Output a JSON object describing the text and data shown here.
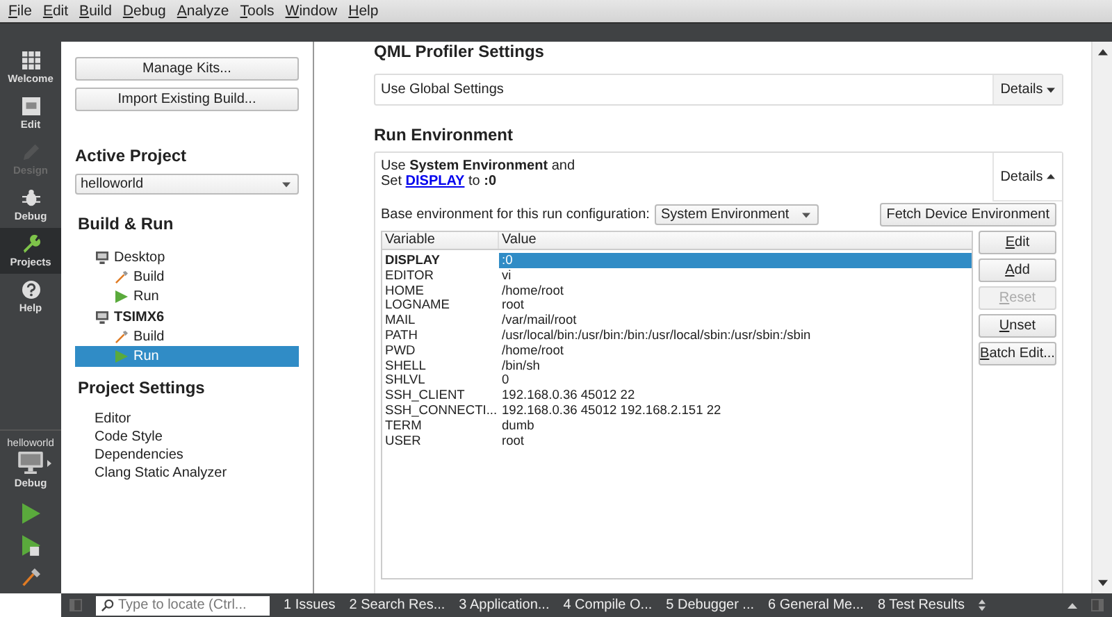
{
  "menu": [
    {
      "label": "File"
    },
    {
      "label": "Edit"
    },
    {
      "label": "Build"
    },
    {
      "label": "Debug"
    },
    {
      "label": "Analyze"
    },
    {
      "label": "Tools"
    },
    {
      "label": "Window"
    },
    {
      "label": "Help"
    }
  ],
  "modes": [
    {
      "label": "Welcome",
      "selected": false,
      "disabled": false
    },
    {
      "label": "Edit",
      "selected": false,
      "disabled": false
    },
    {
      "label": "Design",
      "selected": false,
      "disabled": true
    },
    {
      "label": "Debug",
      "selected": false,
      "disabled": false
    },
    {
      "label": "Projects",
      "selected": true,
      "disabled": false
    },
    {
      "label": "Help",
      "selected": false,
      "disabled": false
    }
  ],
  "kit_selector": {
    "project": "helloworld",
    "config": "Debug"
  },
  "left_panel": {
    "buttons": [
      "Manage Kits...",
      "Import Existing Build..."
    ],
    "active_project_heading": "Active Project",
    "active_project": "helloworld",
    "build_run_heading": "Build & Run",
    "kits": [
      {
        "label": "Desktop",
        "active": false,
        "children": [
          {
            "label": "Build",
            "kind": "build",
            "selected": false
          },
          {
            "label": "Run",
            "kind": "run",
            "selected": false
          }
        ]
      },
      {
        "label": "TSIMX6",
        "active": true,
        "children": [
          {
            "label": "Build",
            "kind": "build",
            "selected": false
          },
          {
            "label": "Run",
            "kind": "run",
            "selected": true
          }
        ]
      }
    ],
    "project_settings_heading": "Project Settings",
    "project_settings": [
      "Editor",
      "Code Style",
      "Dependencies",
      "Clang Static Analyzer"
    ]
  },
  "qml_profiler": {
    "heading": "QML Profiler Settings",
    "summary": "Use Global Settings",
    "details": {
      "label": "Details",
      "expanded": false
    }
  },
  "run_environment": {
    "heading": "Run Environment",
    "summary_line_1": "Use **System Environment** and",
    "summary_line_2": {
      "before": "Set ",
      "link": "DISPLAY",
      "after": " to **:0**"
    },
    "details": {
      "label": "Details",
      "expanded": true
    },
    "base_label": "Base environment for this run configuration:",
    "base_value": "System Environment",
    "fetch_button": "Fetch Device Environment",
    "table": {
      "columns": [
        "Variable",
        "Value"
      ],
      "rows": [
        {
          "variable": "DISPLAY",
          "value": ":0",
          "changed": true,
          "selected": true
        },
        {
          "variable": "EDITOR",
          "value": "vi",
          "changed": false,
          "selected": false
        },
        {
          "variable": "HOME",
          "value": "/home/root",
          "changed": false,
          "selected": false
        },
        {
          "variable": "LOGNAME",
          "value": "root",
          "changed": false,
          "selected": false
        },
        {
          "variable": "MAIL",
          "value": "/var/mail/root",
          "changed": false,
          "selected": false
        },
        {
          "variable": "PATH",
          "value": "/usr/local/bin:/usr/bin:/bin:/usr/local/sbin:/usr/sbin:/sbin",
          "changed": false,
          "selected": false
        },
        {
          "variable": "PWD",
          "value": "/home/root",
          "changed": false,
          "selected": false
        },
        {
          "variable": "SHELL",
          "value": "/bin/sh",
          "changed": false,
          "selected": false
        },
        {
          "variable": "SHLVL",
          "value": "0",
          "changed": false,
          "selected": false
        },
        {
          "variable": "SSH_CLIENT",
          "value": "192.168.0.36 45012 22",
          "changed": false,
          "selected": false
        },
        {
          "variable": "SSH_CONNECTI...",
          "value": "192.168.0.36 45012 192.168.2.151 22",
          "changed": false,
          "selected": false
        },
        {
          "variable": "TERM",
          "value": "dumb",
          "changed": false,
          "selected": false
        },
        {
          "variable": "USER",
          "value": "root",
          "changed": false,
          "selected": false
        }
      ]
    },
    "buttons": [
      {
        "label": "Edit",
        "disabled": false
      },
      {
        "label": "Add",
        "disabled": false
      },
      {
        "label": "Reset",
        "disabled": true
      },
      {
        "label": "Unset",
        "disabled": false
      },
      {
        "label": "Batch Edit...",
        "disabled": false
      }
    ]
  },
  "status_bar": {
    "locate_placeholder": "Type to locate (Ctrl...",
    "panes": [
      "1 Issues",
      "2 Search Res...",
      "3 Application...",
      "4 Compile O...",
      "5 Debugger ...",
      "6 General Me...",
      "8 Test Results"
    ]
  }
}
